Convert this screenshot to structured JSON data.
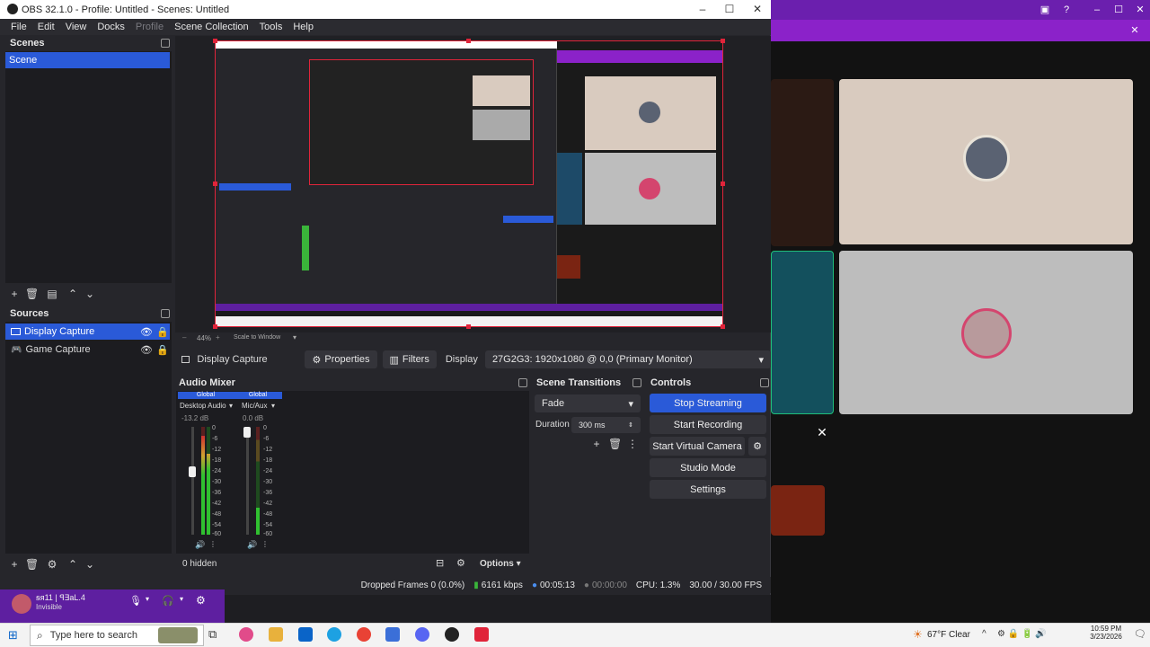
{
  "obs": {
    "title": "OBS 32.1.0 - Profile: Untitled - Scenes: Untitled",
    "menu": [
      "File",
      "Edit",
      "View",
      "Docks",
      "Profile",
      "Scene Collection",
      "Tools",
      "Help"
    ],
    "scenes": {
      "header": "Scenes",
      "items": [
        {
          "label": "Scene",
          "selected": true
        }
      ]
    },
    "sources": {
      "header": "Sources",
      "items": [
        {
          "label": "Display Capture",
          "selected": true
        },
        {
          "label": "Game Capture",
          "selected": false
        }
      ]
    },
    "preview": {
      "zoom": "44%",
      "scale_label": "Scale to Window"
    },
    "source_toolbar": {
      "source_name": "Display Capture",
      "properties": "Properties",
      "filters": "Filters",
      "display_label": "Display",
      "display_value": "27G2G3: 1920x1080 @ 0,0 (Primary Monitor)"
    },
    "audio_mixer": {
      "header": "Audio Mixer",
      "channels": [
        {
          "tag": "Global",
          "name": "Desktop Audio",
          "db": "-13.2 dB"
        },
        {
          "tag": "Global",
          "name": "Mic/Aux",
          "db": "0.0 dB"
        }
      ],
      "scale": [
        "0",
        "-6",
        "-12",
        "-18",
        "-24",
        "-30",
        "-36",
        "-42",
        "-48",
        "-54",
        "-60"
      ],
      "hidden_count": "0 hidden",
      "options": "Options"
    },
    "transitions": {
      "header": "Scene Transitions",
      "transition": "Fade",
      "duration_label": "Duration",
      "duration_value": "300 ms"
    },
    "controls": {
      "header": "Controls",
      "stop_streaming": "Stop Streaming",
      "start_recording": "Start Recording",
      "start_virtual_camera": "Start Virtual Camera",
      "studio_mode": "Studio Mode",
      "settings": "Settings"
    },
    "status": {
      "dropped": "Dropped Frames 0 (0.0%)",
      "bitrate": "6161 kbps",
      "stream_time": "00:05:13",
      "rec_time": "00:00:00",
      "cpu": "CPU: 1.3%",
      "fps": "30.00 / 30.00 FPS"
    }
  },
  "voice_panel": {
    "username": "ꞩᴙ11 | ꟼ∃aL.4",
    "status": "Invisible"
  },
  "taskbar": {
    "search_placeholder": "Type here to search",
    "weather": "67°F  Clear",
    "time": "10:59 PM",
    "date": "3/23/2026"
  },
  "colors": {
    "accent_blue": "#2a5ad8",
    "preview_border": "#e0243a",
    "purple": "#8b22c9"
  }
}
